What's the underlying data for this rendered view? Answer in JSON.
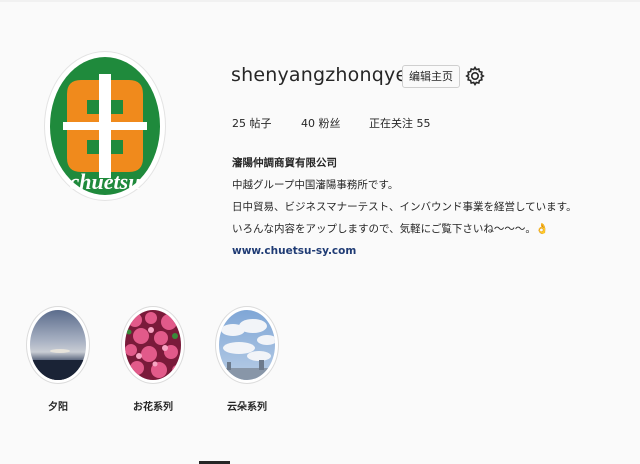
{
  "profile": {
    "username": "shenyangzhonqye",
    "edit_profile_label": "编辑主页",
    "avatar_logo_text": "chuetsu",
    "stats": {
      "posts": "25 帖子",
      "followers": "40 粉丝",
      "following": "正在关注 55"
    },
    "bio": {
      "name": "瀋陽仲調商貿有限公司",
      "lines": [
        "中越グループ中国瀋陽事務所です。",
        "日中貿易、ビジネスマナーテスト、インバウンド事業を経営しています。",
        "いろんな内容をアップしますので、気軽にご覧下さいね～～～。"
      ],
      "emoji": "👌",
      "link": "www.chuetsu-sy.com"
    }
  },
  "highlights": [
    {
      "label": "夕阳"
    },
    {
      "label": "お花系列"
    },
    {
      "label": "云朵系列"
    }
  ],
  "colors": {
    "logo_green": "#1f8a3c",
    "logo_orange": "#f08a1c",
    "link": "#1f3b74",
    "text": "#262626"
  }
}
